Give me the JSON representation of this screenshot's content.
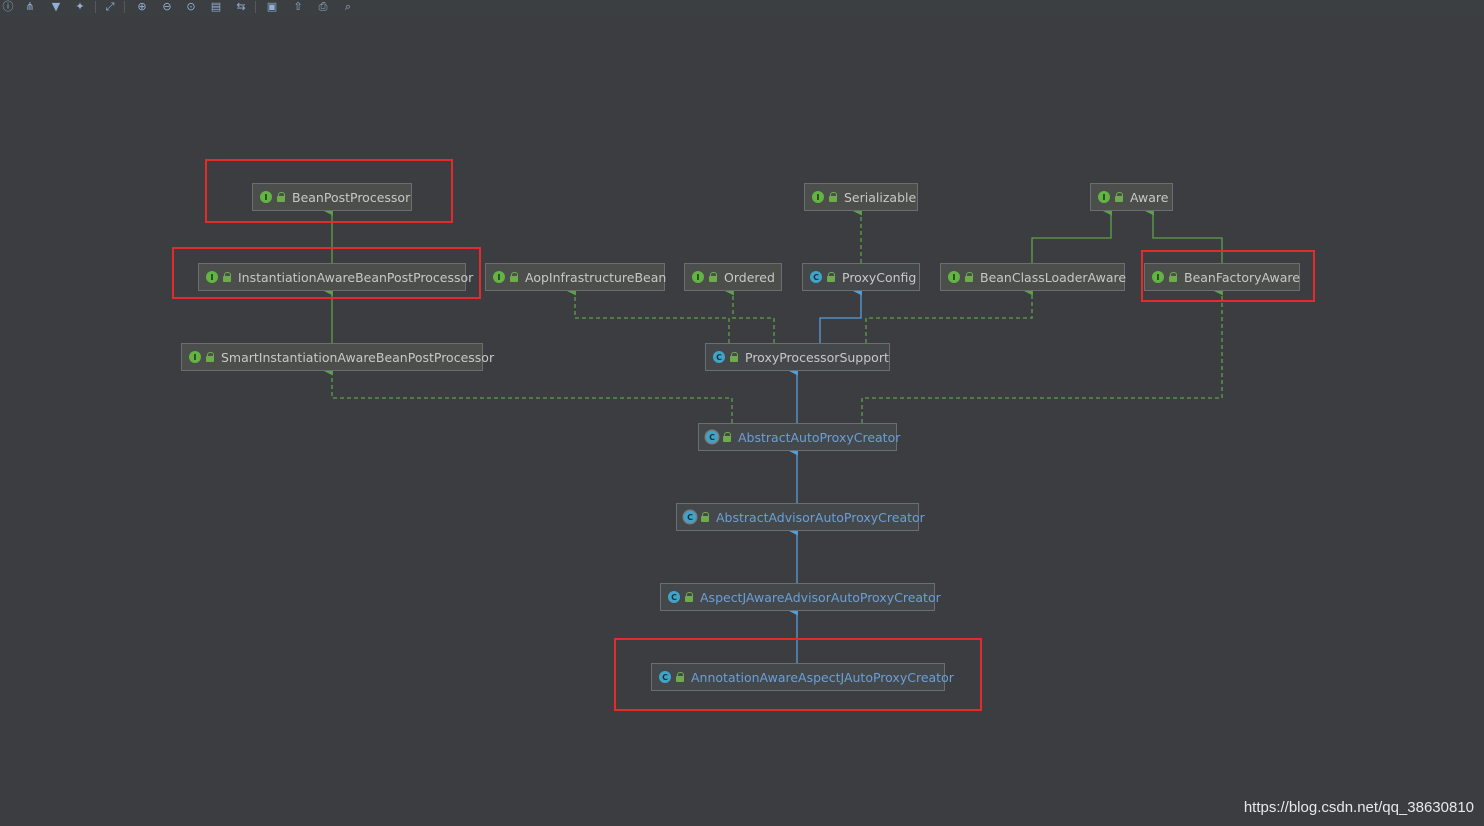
{
  "toolbar": {
    "icons": [
      "info-icon",
      "tree-icon",
      "filter-icon",
      "pin-icon",
      "link-icon",
      "zoom-in-icon",
      "zoom-out-icon",
      "actual-size-icon",
      "layout-icon",
      "apply-layout-icon",
      "save-icon",
      "export-icon",
      "print-icon",
      "magnifier-icon"
    ]
  },
  "colors": {
    "background": "#3b3d40",
    "generalization_solid": "#5b9bd5",
    "realization_dashed": "#5fa04e",
    "interface_badge": "#62b543",
    "class_badge": "#40a4c8",
    "highlight": "#e32b2b"
  },
  "nodes": {
    "bean_post_processor": {
      "kind": "interface",
      "badge": "I",
      "label": "BeanPostProcessor"
    },
    "serializable": {
      "kind": "interface",
      "badge": "I",
      "label": "Serializable"
    },
    "aware": {
      "kind": "interface",
      "badge": "I",
      "label": "Aware"
    },
    "instantiation_aware_bpp": {
      "kind": "interface",
      "badge": "I",
      "label": "InstantiationAwareBeanPostProcessor"
    },
    "aop_infrastructure_bean": {
      "kind": "interface",
      "badge": "I",
      "label": "AopInfrastructureBean"
    },
    "ordered": {
      "kind": "interface",
      "badge": "I",
      "label": "Ordered"
    },
    "proxy_config": {
      "kind": "class",
      "badge": "C",
      "label": "ProxyConfig"
    },
    "bean_class_loader_aware": {
      "kind": "interface",
      "badge": "I",
      "label": "BeanClassLoaderAware"
    },
    "bean_factory_aware": {
      "kind": "interface",
      "badge": "I",
      "label": "BeanFactoryAware"
    },
    "smart_instantiation_aware_bpp": {
      "kind": "interface",
      "badge": "I",
      "label": "SmartInstantiationAwareBeanPostProcessor"
    },
    "proxy_processor_support": {
      "kind": "class",
      "badge": "C",
      "label": "ProxyProcessorSupport"
    },
    "abstract_auto_proxy_creator": {
      "kind": "abstract",
      "badge": "C",
      "label": "AbstractAutoProxyCreator"
    },
    "abstract_advisor_auto_proxy_creator": {
      "kind": "abstract",
      "badge": "C",
      "label": "AbstractAdvisorAutoProxyCreator"
    },
    "aspectj_aware_advisor_auto_proxy_creator": {
      "kind": "class",
      "badge": "C",
      "label": "AspectJAwareAdvisorAutoProxyCreator"
    },
    "annotation_aware_aspectj_auto_proxy_creator": {
      "kind": "class",
      "badge": "C",
      "label": "AnnotationAwareAspectJAutoProxyCreator"
    }
  },
  "relations": [
    {
      "from": "instantiation_aware_bpp",
      "to": "bean_post_processor",
      "type": "extends"
    },
    {
      "from": "smart_instantiation_aware_bpp",
      "to": "instantiation_aware_bpp",
      "type": "extends"
    },
    {
      "from": "proxy_config",
      "to": "serializable",
      "type": "implements"
    },
    {
      "from": "bean_class_loader_aware",
      "to": "aware",
      "type": "extends"
    },
    {
      "from": "bean_factory_aware",
      "to": "aware",
      "type": "extends"
    },
    {
      "from": "proxy_processor_support",
      "to": "aop_infrastructure_bean",
      "type": "implements"
    },
    {
      "from": "proxy_processor_support",
      "to": "ordered",
      "type": "implements"
    },
    {
      "from": "proxy_processor_support",
      "to": "proxy_config",
      "type": "extends"
    },
    {
      "from": "proxy_processor_support",
      "to": "bean_class_loader_aware",
      "type": "implements"
    },
    {
      "from": "abstract_auto_proxy_creator",
      "to": "proxy_processor_support",
      "type": "extends"
    },
    {
      "from": "abstract_auto_proxy_creator",
      "to": "smart_instantiation_aware_bpp",
      "type": "implements"
    },
    {
      "from": "abstract_auto_proxy_creator",
      "to": "bean_factory_aware",
      "type": "implements"
    },
    {
      "from": "abstract_advisor_auto_proxy_creator",
      "to": "abstract_auto_proxy_creator",
      "type": "extends"
    },
    {
      "from": "aspectj_aware_advisor_auto_proxy_creator",
      "to": "abstract_advisor_auto_proxy_creator",
      "type": "extends"
    },
    {
      "from": "annotation_aware_aspectj_auto_proxy_creator",
      "to": "aspectj_aware_advisor_auto_proxy_creator",
      "type": "extends"
    }
  ],
  "highlighted": [
    "bean_post_processor",
    "instantiation_aware_bpp",
    "bean_factory_aware",
    "annotation_aware_aspectj_auto_proxy_creator"
  ],
  "watermark": "https://blog.csdn.net/qq_38630810"
}
